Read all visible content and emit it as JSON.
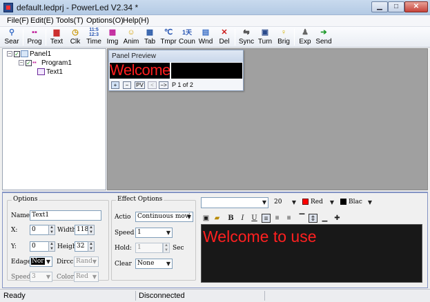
{
  "window": {
    "title": "default.ledprj - PowerLed V2.34 *"
  },
  "menu": [
    "File(F)",
    "Edit(E)",
    "Tools(T)",
    "Options(O)",
    "Help(H)"
  ],
  "toolbar": {
    "sear": "Sear",
    "prog": "Prog",
    "text": "Text",
    "clk": "Clk",
    "time": "Time",
    "img": "Img",
    "anim": "Anim",
    "tab": "Tab",
    "tmpr": "Tmpr",
    "coun": "Coun",
    "wnd": "Wnd",
    "del": "Del",
    "sync": "Sync",
    "turn": "Turn",
    "brig": "Brig",
    "exp": "Exp",
    "send": "Send"
  },
  "tree": {
    "panel": "Panel1",
    "program": "Program1",
    "text": "Text1"
  },
  "preview": {
    "title": "Panel Preview",
    "led_text": "Welcome to use",
    "btn_plus": "+",
    "btn_minus": "−",
    "btn_pv": "PV",
    "btn_prev": "<",
    "btn_next": "−>",
    "page": "P 1 of 2"
  },
  "options": {
    "title": "Options",
    "name_label": "Name:",
    "name_value": "Text1",
    "x_label": "X:",
    "x_value": "0",
    "width_label": "Width",
    "width_value": "118",
    "y_label": "Y:",
    "y_value": "0",
    "height_label": "Heigh",
    "height_value": "32",
    "edge_label": "Edage",
    "edge_value": "Nor",
    "direction_label": "Dircc",
    "direction_value": "Rand",
    "speed_label": "Speed",
    "speed_value": "3",
    "color_label": "Color",
    "color_value": "Red"
  },
  "effect": {
    "title": "Effect Options",
    "action_label": "Actio",
    "action_value": "Continuous movi",
    "speed_label": "Speed",
    "speed_value": "1",
    "hold_label": "Hold:",
    "hold_value": "1",
    "hold_unit": "Sec",
    "clear_label": "Clear",
    "clear_value": "None"
  },
  "editor": {
    "font_value": "",
    "size_value": "20",
    "fg_color_name": "Red",
    "fg_color": "#ff0000",
    "bg_color_name": "Blac",
    "bg_color": "#000000",
    "bold": "B",
    "italic": "I",
    "underline": "U",
    "content": "Welcome to use"
  },
  "status": {
    "left": "Ready",
    "connection": "Disconnected"
  },
  "colors": {
    "led_text": "#ff2020",
    "accent": "#8393c4"
  }
}
